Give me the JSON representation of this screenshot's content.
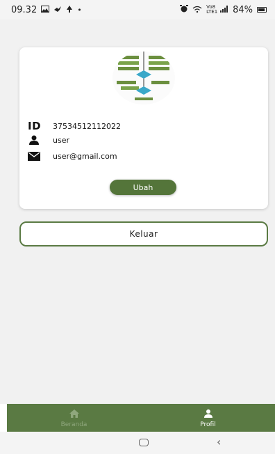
{
  "status_bar": {
    "time": "09.32",
    "left_icons": [
      "image-icon",
      "bird-icon",
      "tree-icon",
      "dot-icon"
    ],
    "network": "Vo8 LTE1",
    "battery": "84%"
  },
  "profile": {
    "id_label": "ID",
    "id_value": "37534512112022",
    "username": "user",
    "email": "user@gmail.com",
    "edit_button": "Ubah"
  },
  "logout_button": "Keluar",
  "bottom_nav": {
    "items": [
      {
        "label": "Beranda",
        "icon": "home-icon",
        "active": false
      },
      {
        "label": "Profil",
        "icon": "person-icon",
        "active": true
      }
    ]
  },
  "colors": {
    "primary": "#5a7a43",
    "button": "#54753a",
    "inactive_nav": "#8fa77d"
  }
}
